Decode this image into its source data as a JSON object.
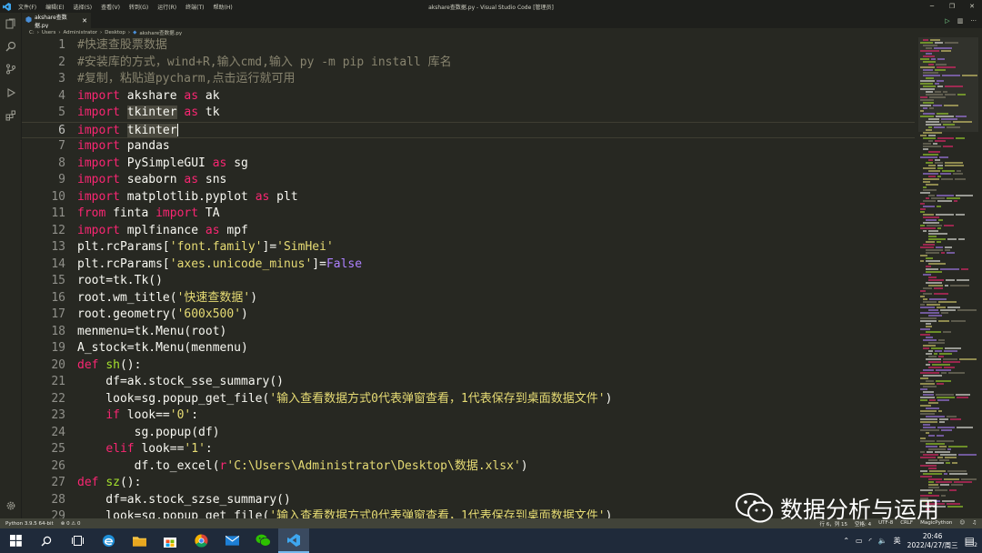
{
  "titlebar": {
    "menu": [
      "文件(F)",
      "编辑(E)",
      "选择(S)",
      "查看(V)",
      "转到(G)",
      "运行(R)",
      "终端(T)",
      "帮助(H)"
    ],
    "window_title": "akshare查数据.py - Visual Studio Code [管理员]"
  },
  "tab": {
    "label": "akshare查数据.py"
  },
  "breadcrumb": [
    "C:",
    "Users",
    "Administrator",
    "Desktop",
    "akshare查数据.py"
  ],
  "lines": [
    [
      [
        "cm",
        "#快速查股票数据"
      ]
    ],
    [
      [
        "cm",
        "#安装库的方式，wind+R,输入cmd,输入 py -m pip install 库名"
      ]
    ],
    [
      [
        "cm",
        "#复制，粘贴道pycharm,点击运行就可用"
      ]
    ],
    [
      [
        "kw",
        "import"
      ],
      [
        "",
        " akshare "
      ],
      [
        "kw",
        "as"
      ],
      [
        "",
        " ak"
      ]
    ],
    [
      [
        "kw",
        "import"
      ],
      [
        "",
        " "
      ],
      [
        "hl",
        "tkinter"
      ],
      [
        "",
        " "
      ],
      [
        "kw",
        "as"
      ],
      [
        "",
        " tk"
      ]
    ],
    [
      [
        "kw",
        "import"
      ],
      [
        "",
        " "
      ],
      [
        "hl",
        "tkinter"
      ]
    ],
    [
      [
        "kw",
        "import"
      ],
      [
        "",
        " pandas"
      ]
    ],
    [
      [
        "kw",
        "import"
      ],
      [
        "",
        " PySimpleGUI "
      ],
      [
        "kw",
        "as"
      ],
      [
        "",
        " sg"
      ]
    ],
    [
      [
        "kw",
        "import"
      ],
      [
        "",
        " seaborn "
      ],
      [
        "kw",
        "as"
      ],
      [
        "",
        " sns"
      ]
    ],
    [
      [
        "kw",
        "import"
      ],
      [
        "",
        " matplotlib.pyplot "
      ],
      [
        "kw",
        "as"
      ],
      [
        "",
        " plt"
      ]
    ],
    [
      [
        "kw",
        "from"
      ],
      [
        "",
        " finta "
      ],
      [
        "kw",
        "import"
      ],
      [
        "",
        " TA"
      ]
    ],
    [
      [
        "kw",
        "import"
      ],
      [
        "",
        " mplfinance "
      ],
      [
        "kw",
        "as"
      ],
      [
        "",
        " mpf"
      ]
    ],
    [
      [
        "",
        "plt.rcParams["
      ],
      [
        "st",
        "'font.family'"
      ],
      [
        "",
        "]="
      ],
      [
        "st",
        "'SimHei'"
      ]
    ],
    [
      [
        "",
        "plt.rcParams["
      ],
      [
        "st",
        "'axes.unicode_minus'"
      ],
      [
        "",
        "]="
      ],
      [
        "cn",
        "False"
      ]
    ],
    [
      [
        "",
        "root=tk.Tk()"
      ]
    ],
    [
      [
        "",
        "root.wm_title("
      ],
      [
        "st",
        "'快速查数据'"
      ],
      [
        "",
        ")"
      ]
    ],
    [
      [
        "",
        "root.geometry("
      ],
      [
        "st",
        "'600x500'"
      ],
      [
        "",
        ")"
      ]
    ],
    [
      [
        "",
        "menmenu=tk.Menu(root)"
      ]
    ],
    [
      [
        "",
        "A_stock=tk.Menu(menmenu)"
      ]
    ],
    [
      [
        "kw",
        "def"
      ],
      [
        "",
        " "
      ],
      [
        "fn",
        "sh"
      ],
      [
        "",
        "():"
      ]
    ],
    [
      [
        "",
        "    df=ak.stock_sse_summary()"
      ]
    ],
    [
      [
        "",
        "    look=sg.popup_get_file("
      ],
      [
        "st",
        "'输入查看数据方式0代表弹窗查看，1代表保存到桌面数据文件'"
      ],
      [
        "",
        ")"
      ]
    ],
    [
      [
        "",
        "    "
      ],
      [
        "kw",
        "if"
      ],
      [
        "",
        " look=="
      ],
      [
        "st",
        "'0'"
      ],
      [
        "",
        ":"
      ]
    ],
    [
      [
        "",
        "        sg.popup(df)"
      ]
    ],
    [
      [
        "",
        "    "
      ],
      [
        "kw",
        "elif"
      ],
      [
        "",
        " look=="
      ],
      [
        "st",
        "'1'"
      ],
      [
        "",
        ":"
      ]
    ],
    [
      [
        "",
        "        df.to_excel("
      ],
      [
        "kw",
        "r"
      ],
      [
        "st",
        "'C:\\Users\\Administrator\\Desktop\\数据.xlsx'"
      ],
      [
        "",
        ")"
      ]
    ],
    [
      [
        "kw",
        "def"
      ],
      [
        "",
        " "
      ],
      [
        "fn",
        "sz"
      ],
      [
        "",
        "():"
      ]
    ],
    [
      [
        "",
        "    df=ak.stock_szse_summary()"
      ]
    ],
    [
      [
        "",
        "    look=sg.popup_get_file("
      ],
      [
        "st",
        "'输入查看数据方式0代表弹窗查看，1代表保存到桌面数据文件'"
      ],
      [
        "",
        ")"
      ]
    ]
  ],
  "statusbar": {
    "python": "Python 3.9.5 64-bit",
    "problems": "⊗ 0 ⚠ 0",
    "position": "行 6，列 15",
    "spaces": "空格: 4",
    "encoding": "UTF-8",
    "eol": "CRLF",
    "language": "MagicPython"
  },
  "taskbar": {
    "time": "20:46",
    "date": "2022/4/27/周三",
    "ime": "英",
    "notif_count": "2"
  },
  "watermark": "数据分析与运用"
}
